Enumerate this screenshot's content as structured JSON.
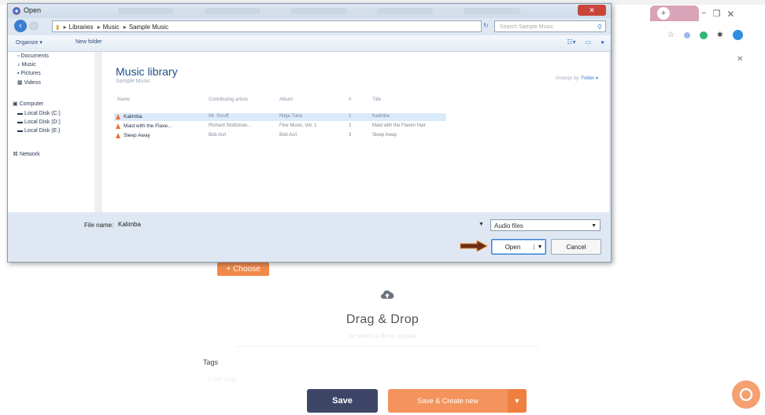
{
  "dialog": {
    "title": "Open",
    "close_label": "✕",
    "back_icon": "back-arrow-icon",
    "forward_icon": "forward-arrow-icon",
    "breadcrumb": [
      "Libraries",
      "Music",
      "Sample Music"
    ],
    "search_placeholder": "Search Sample Music",
    "organize_label": "Organize ▾",
    "new_folder_label": "New folder",
    "nav": {
      "favorites": [
        "Documents",
        "Music",
        "Pictures",
        "Videos"
      ],
      "computer": "Computer",
      "drives": [
        "Local Disk (C:)",
        "Local Disk (D:)",
        "Local Disk (E:)"
      ],
      "network": "Network"
    },
    "library": {
      "title": "Music library",
      "subtitle": "Sample Music",
      "arrange_label": "Arrange by:",
      "arrange_value": "Folder ▾"
    },
    "columns": [
      "Name",
      "Contributing artists",
      "Album",
      "#",
      "Title"
    ],
    "files": [
      {
        "name": "Kalimba",
        "artist": "Mr. Scruff",
        "album": "Ninja Tuna",
        "num": "1",
        "title": "Kalimba"
      },
      {
        "name": "Maid with the Flaxe...",
        "artist": "Richard Stoltzman...",
        "album": "Fine Music, Vol. 1",
        "num": "2",
        "title": "Maid with the Flaxen Hair"
      },
      {
        "name": "Sleep Away",
        "artist": "Bob Acri",
        "album": "Bob Acri",
        "num": "3",
        "title": "Sleep Away"
      }
    ],
    "filename_label": "File name:",
    "filename_value": "Kalimba",
    "filter_value": "Audio files",
    "open_label": "Open",
    "cancel_label": "Cancel"
  },
  "page": {
    "choose_label": "Choose",
    "dragdrop_title": "Drag & Drop",
    "dragdrop_sub": "or select a file to upload",
    "tags_label": "Tags",
    "tags_placeholder": "Enter tags",
    "save_label": "Save",
    "save_create_label": "Save & Create new"
  },
  "browser": {
    "new_tab_label": "+",
    "window_controls": [
      "−",
      "❐",
      "✕"
    ],
    "ext_close": "✕"
  },
  "colors": {
    "accent_orange": "#f08a4b",
    "save_navy": "#3d4667",
    "dialog_blue": "#1e4e8c"
  }
}
